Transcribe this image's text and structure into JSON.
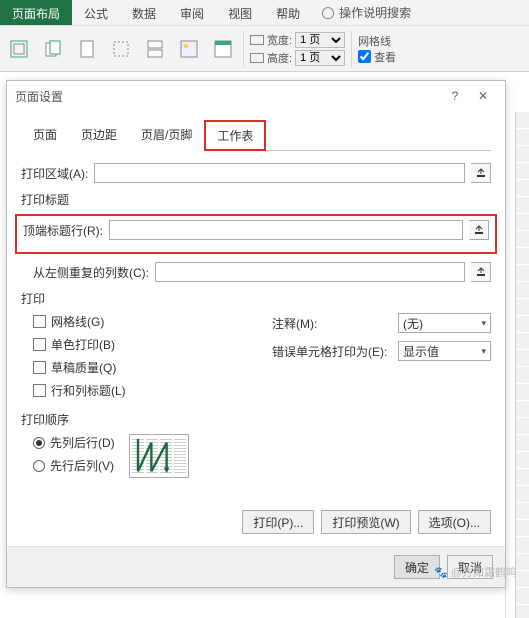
{
  "ribbon": {
    "tabs": [
      "页面布局",
      "公式",
      "数据",
      "审阅",
      "视图",
      "帮助"
    ],
    "help_hint": "操作说明搜索",
    "width_label": "宽度:",
    "height_label": "高度:",
    "page_option": "1 页",
    "grid_label": "网格线",
    "view_check": "查看"
  },
  "dialog": {
    "title": "页面设置",
    "tabs": {
      "page": "页面",
      "margins": "页边距",
      "headerfooter": "页眉/页脚",
      "sheet": "工作表"
    },
    "print_area_label": "打印区域(A):",
    "print_titles_label": "打印标题",
    "top_rows_label": "顶端标题行(R):",
    "left_cols_label": "从左侧重复的列数(C):",
    "print_section": "打印",
    "gridlines": "网格线(G)",
    "bw": "单色打印(B)",
    "draft": "草稿质量(Q)",
    "rowcol": "行和列标题(L)",
    "comments_label": "注释(M):",
    "comments_value": "(无)",
    "errors_label": "错误单元格打印为(E):",
    "errors_value": "显示值",
    "order_label": "打印顺序",
    "order_down": "先列后行(D)",
    "order_over": "先行后列(V)",
    "btn_print": "打印(P)...",
    "btn_preview": "打印预览(W)",
    "btn_options": "选项(O)...",
    "btn_ok": "确定",
    "btn_cancel": "取消"
  },
  "watermark": "🐾 @方知霜鹤鸣"
}
